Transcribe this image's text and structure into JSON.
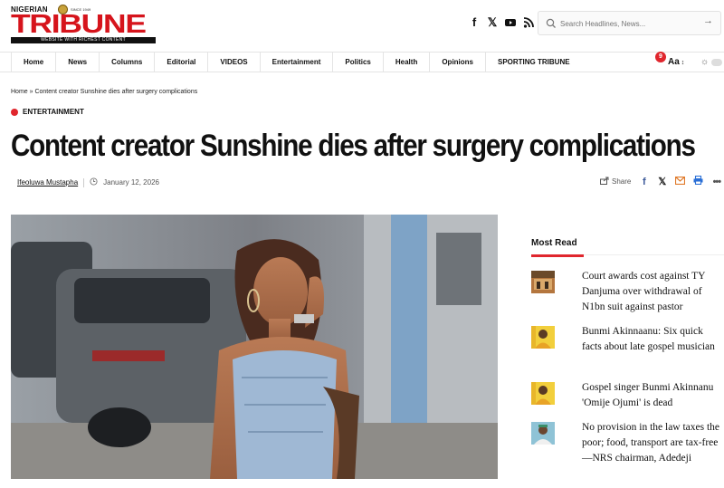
{
  "brand": {
    "top_line": "NIGERIAN",
    "since": "SINCE 1949",
    "name": "TRIBUNE",
    "tagline": "WEBSITE WITH RICHEST CONTENT"
  },
  "social_icons": [
    "facebook-icon",
    "x-icon",
    "youtube-icon",
    "rss-icon"
  ],
  "search": {
    "placeholder": "Search Headlines, News..."
  },
  "nav": {
    "items": [
      "Home",
      "News",
      "Columns",
      "Editorial",
      "VIDEOS",
      "Entertainment",
      "Politics",
      "Health",
      "Opinions",
      "SPORTING TRIBUNE"
    ],
    "notification_count": "9",
    "font_size_label": "Aa"
  },
  "article": {
    "breadcrumb": "Home » Content creator Sunshine dies after surgery complications",
    "category": "ENTERTAINMENT",
    "title": "Content creator Sunshine dies after surgery complications",
    "author": "Ifeoluwa Mustapha",
    "date": "January 12, 2026",
    "share_label": "Share"
  },
  "most_read": {
    "title": "Most Read",
    "items": [
      {
        "title": "Court awards cost against TY Danjuma over withdrawal of N1bn suit against pastor"
      },
      {
        "title": "Bunmi Akinnaanu: Six quick facts about late gospel musician"
      },
      {
        "title": "Gospel singer Bunmi Akinnanu 'Omije Ojumi' is dead"
      },
      {
        "title": "No provision in the law taxes the poor; food, transport are tax-free —NRS chairman, Adedeji"
      }
    ]
  },
  "colors": {
    "brand_red": "#d6141c",
    "accent_red": "#e0262d"
  }
}
